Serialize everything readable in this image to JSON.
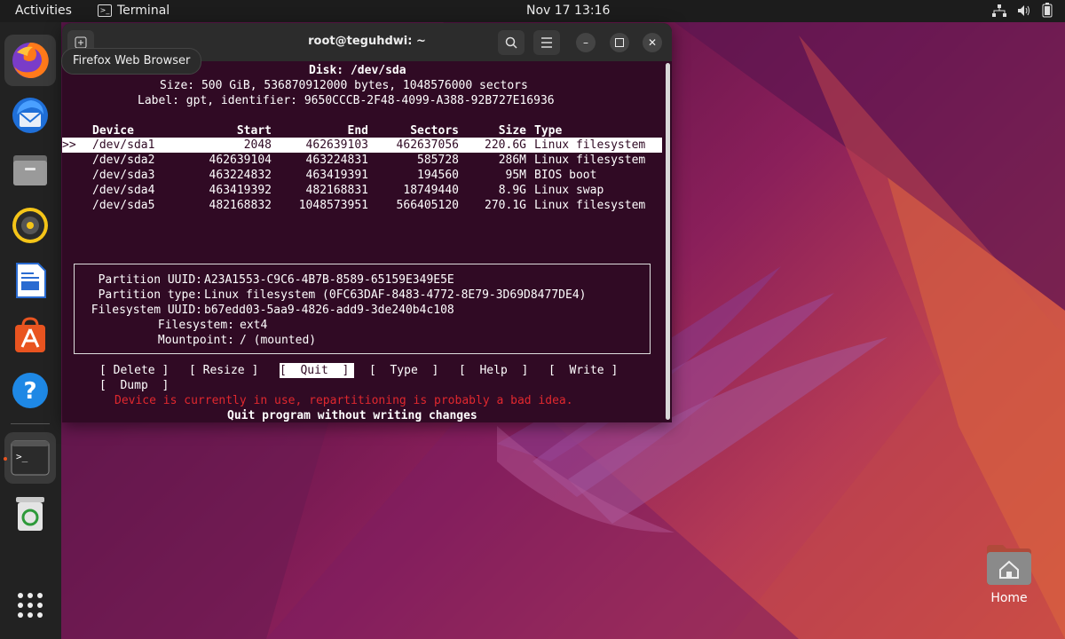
{
  "topbar": {
    "activities": "Activities",
    "app_name": "Terminal",
    "clock": "Nov 17  13:16"
  },
  "dock": {
    "items": [
      {
        "name": "Firefox Web Browser",
        "icon": "firefox-icon"
      },
      {
        "name": "Thunderbird",
        "icon": "thunderbird-icon"
      },
      {
        "name": "Files",
        "icon": "files-icon"
      },
      {
        "name": "Rhythmbox",
        "icon": "rhythmbox-icon"
      },
      {
        "name": "LibreOffice Writer",
        "icon": "writer-icon"
      },
      {
        "name": "Ubuntu Software",
        "icon": "software-icon"
      },
      {
        "name": "Help",
        "icon": "help-icon"
      },
      {
        "name": "Terminal",
        "icon": "terminal-icon"
      },
      {
        "name": "Trash",
        "icon": "trash-icon"
      }
    ],
    "tooltip": "Firefox Web Browser"
  },
  "terminal": {
    "title": "root@teguhdwi: ~",
    "disk_title": "Disk: /dev/sda",
    "size_line": "Size: 500 GiB, 536870912000 bytes, 1048576000 sectors",
    "label_line": "Label: gpt, identifier: 9650CCCB-2F48-4099-A388-92B727E16936",
    "columns": [
      "Device",
      "Start",
      "End",
      "Sectors",
      "Size",
      "Type"
    ],
    "selection_marker": ">>",
    "partitions": [
      {
        "device": "/dev/sda1",
        "start": "2048",
        "end": "462639103",
        "sectors": "462637056",
        "size": "220.6G",
        "type": "Linux filesystem"
      },
      {
        "device": "/dev/sda2",
        "start": "462639104",
        "end": "463224831",
        "sectors": "585728",
        "size": "286M",
        "type": "Linux filesystem"
      },
      {
        "device": "/dev/sda3",
        "start": "463224832",
        "end": "463419391",
        "sectors": "194560",
        "size": "95M",
        "type": "BIOS boot"
      },
      {
        "device": "/dev/sda4",
        "start": "463419392",
        "end": "482168831",
        "sectors": "18749440",
        "size": "8.9G",
        "type": "Linux swap"
      },
      {
        "device": "/dev/sda5",
        "start": "482168832",
        "end": "1048573951",
        "sectors": "566405120",
        "size": "270.1G",
        "type": "Linux filesystem"
      }
    ],
    "info": [
      {
        "key": "Partition UUID:",
        "value": "A23A1553-C9C6-4B7B-8589-65159E349E5E"
      },
      {
        "key": "Partition type:",
        "value": "Linux filesystem (0FC63DAF-8483-4772-8E79-3D69D8477DE4)"
      },
      {
        "key": "Filesystem UUID:",
        "value": "b67edd03-5aa9-4826-add9-3de240b4c108"
      },
      {
        "key": "Filesystem:",
        "value": "ext4"
      },
      {
        "key": "Mountpoint:",
        "value": "/ (mounted)"
      }
    ],
    "menu": {
      "delete": "Delete",
      "resize": "Resize",
      "quit": "Quit",
      "type": "Type",
      "help": "Help",
      "write": "Write",
      "dump": "Dump"
    },
    "warning": "Device is currently in use, repartitioning is probably a bad idea.",
    "status": "Quit program without writing changes"
  },
  "desktop": {
    "home_label": "Home"
  },
  "colors": {
    "terminal_bg": "#300a24",
    "accent": "#e95420",
    "warning_red": "#e0282e"
  }
}
